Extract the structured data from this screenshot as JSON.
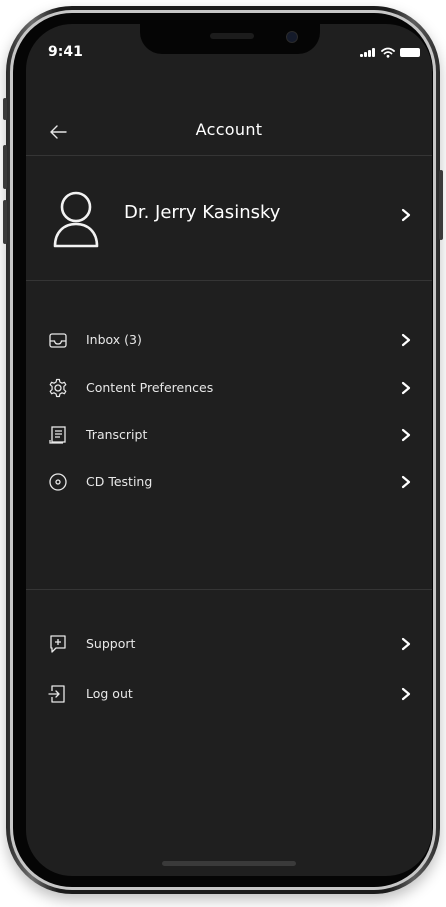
{
  "status_bar": {
    "time": "9:41"
  },
  "header": {
    "title": "Account",
    "back_icon": "arrow-left-icon"
  },
  "profile": {
    "name": "Dr. Jerry Kasinsky",
    "avatar_icon": "user-outline-icon"
  },
  "menu": {
    "primary": [
      {
        "label": "Inbox (3)",
        "icon": "inbox-icon"
      },
      {
        "label": "Content Preferences",
        "icon": "gear-icon"
      },
      {
        "label": "Transcript",
        "icon": "document-icon"
      },
      {
        "label": "CD Testing",
        "icon": "disc-icon"
      }
    ],
    "secondary": [
      {
        "label": "Support",
        "icon": "chat-plus-icon"
      },
      {
        "label": "Log out",
        "icon": "logout-icon"
      }
    ]
  },
  "colors": {
    "screen_background": "#1f1f1f",
    "text": "#ffffff",
    "divider": "#353535"
  }
}
